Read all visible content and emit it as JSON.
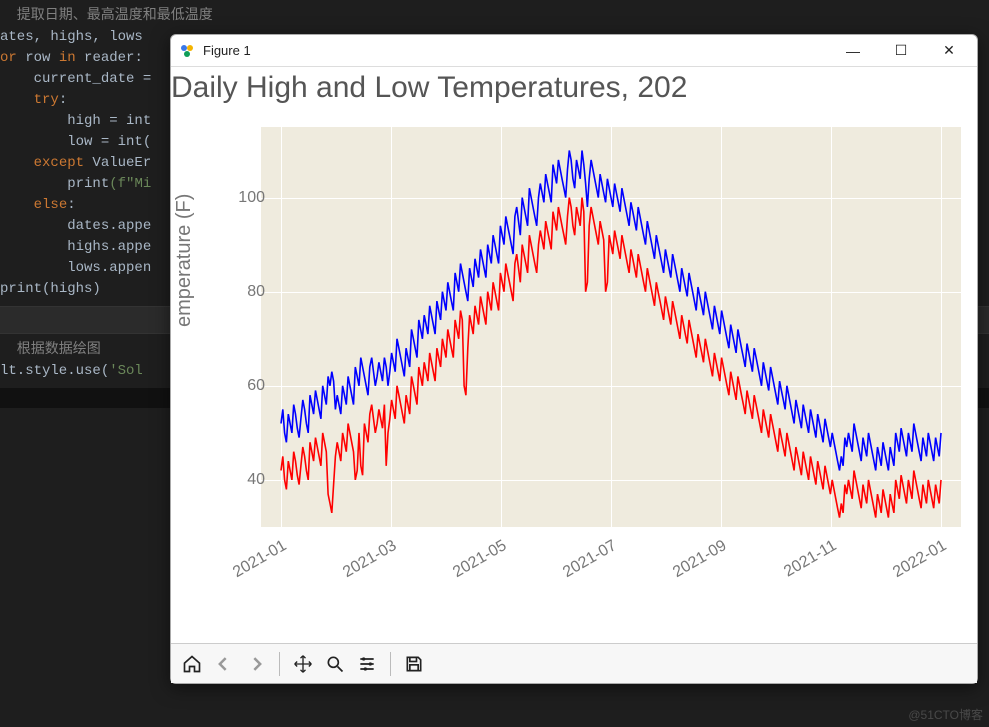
{
  "editor": {
    "comment1": "  提取日期、最高温度和最低温度",
    "l1": "ates, highs, lows",
    "l2_a": "or ",
    "l2_b": "row ",
    "l2_c": "in ",
    "l2_d": "reader:",
    "l3": "    current_date =",
    "l4_a": "    ",
    "l4_b": "try",
    "l4_c": ":",
    "l5": "        high = int",
    "l6": "        low = int(",
    "l7_a": "    ",
    "l7_b": "except ",
    "l7_c": "ValueEr",
    "l8_a": "        ",
    "l8_b": "print",
    "l8_c": "(f\"Mi",
    "l9_a": "    ",
    "l9_b": "else",
    "l9_c": ":",
    "l10": "        dates.appe",
    "l11": "        highs.appe",
    "l12": "        lows.appen",
    "l13_a": "print",
    "l13_b": "(highs)",
    "comment2": "  根据数据绘图",
    "l14_a": "lt.style.use(",
    "l14_b": "'Sol"
  },
  "figure": {
    "window_title": "Figure 1",
    "minimize": "—",
    "maximize": "☐",
    "close": "✕"
  },
  "toolbar": {
    "home": "home-icon",
    "back": "back-icon",
    "forward": "forward-icon",
    "pan": "pan-icon",
    "zoom": "zoom-icon",
    "config": "config-icon",
    "save": "save-icon"
  },
  "watermark": "@51CTO博客",
  "chart_data": {
    "type": "line",
    "title": "Daily High and Low Temperatures, 202",
    "ylabel": "emperature (F)",
    "xlabel": "",
    "ylim": [
      30,
      115
    ],
    "yticks": [
      40,
      60,
      80,
      100
    ],
    "xticks": [
      "2021-01",
      "2021-03",
      "2021-05",
      "2021-07",
      "2021-09",
      "2021-11",
      "2022-01"
    ],
    "x_start": "2021-01-15",
    "x_end": "2022-01-15",
    "colors": {
      "highs": "#0000ff",
      "lows": "#ff0000"
    },
    "series": [
      {
        "name": "highs",
        "values": [
          52,
          55,
          50,
          48,
          54,
          52,
          50,
          56,
          54,
          51,
          49,
          53,
          57,
          55,
          52,
          50,
          58,
          56,
          54,
          59,
          57,
          55,
          53,
          60,
          58,
          56,
          62,
          60,
          63,
          61,
          55,
          58,
          56,
          54,
          60,
          58,
          56,
          62,
          60,
          58,
          56,
          64,
          62,
          60,
          66,
          64,
          62,
          60,
          58,
          64,
          66,
          63,
          60,
          62,
          65,
          63,
          61,
          66,
          64,
          60,
          63,
          67,
          65,
          63,
          70,
          68,
          66,
          64,
          62,
          68,
          66,
          64,
          72,
          70,
          68,
          66,
          74,
          72,
          70,
          75,
          73,
          71,
          77,
          75,
          73,
          71,
          78,
          76,
          74,
          80,
          78,
          76,
          82,
          80,
          78,
          76,
          84,
          82,
          80,
          86,
          84,
          82,
          80,
          78,
          85,
          83,
          81,
          87,
          85,
          83,
          89,
          87,
          85,
          83,
          90,
          88,
          86,
          92,
          90,
          88,
          86,
          94,
          92,
          90,
          96,
          94,
          92,
          90,
          88,
          96,
          98,
          95,
          92,
          100,
          98,
          96,
          94,
          102,
          100,
          98,
          96,
          94,
          100,
          103,
          101,
          99,
          105,
          103,
          101,
          99,
          107,
          105,
          103,
          108,
          106,
          104,
          102,
          100,
          106,
          110,
          108,
          104,
          102,
          108,
          106,
          104,
          110,
          107,
          103,
          98,
          104,
          108,
          106,
          104,
          102,
          100,
          105,
          103,
          101,
          99,
          104,
          102,
          100,
          98,
          103,
          101,
          99,
          97,
          102,
          100,
          98,
          96,
          94,
          99,
          97,
          95,
          93,
          98,
          96,
          94,
          92,
          90,
          95,
          93,
          91,
          89,
          87,
          92,
          90,
          88,
          86,
          84,
          89,
          87,
          85,
          83,
          88,
          86,
          84,
          82,
          80,
          85,
          83,
          81,
          79,
          84,
          82,
          80,
          78,
          76,
          81,
          79,
          77,
          75,
          80,
          78,
          76,
          74,
          72,
          77,
          75,
          73,
          71,
          76,
          74,
          72,
          70,
          68,
          73,
          71,
          69,
          67,
          72,
          70,
          68,
          66,
          64,
          69,
          67,
          65,
          63,
          68,
          66,
          64,
          62,
          60,
          65,
          63,
          61,
          59,
          64,
          62,
          60,
          58,
          56,
          61,
          59,
          57,
          55,
          60,
          58,
          56,
          54,
          52,
          57,
          55,
          53,
          51,
          56,
          54,
          52,
          50,
          55,
          53,
          51,
          49,
          54,
          52,
          50,
          48,
          53,
          51,
          49,
          47,
          50,
          48,
          46,
          44,
          42,
          45,
          43,
          49,
          47,
          50,
          48,
          46,
          52,
          50,
          48,
          46,
          44,
          49,
          47,
          45,
          50,
          48,
          46,
          44,
          42,
          47,
          45,
          43,
          48,
          46,
          44,
          42,
          47,
          45,
          43,
          50,
          48,
          46,
          51,
          49,
          47,
          45,
          50,
          48,
          46,
          52,
          50,
          48,
          46,
          44,
          49,
          47,
          45,
          50,
          48,
          46,
          44,
          49,
          47,
          45,
          50
        ]
      },
      {
        "name": "lows",
        "values": [
          42,
          45,
          40,
          38,
          44,
          42,
          40,
          46,
          44,
          41,
          39,
          43,
          47,
          45,
          42,
          40,
          48,
          46,
          44,
          49,
          47,
          45,
          43,
          50,
          48,
          46,
          37,
          35,
          33,
          39,
          45,
          48,
          46,
          44,
          50,
          48,
          46,
          52,
          50,
          48,
          46,
          40,
          42,
          50,
          43,
          41,
          52,
          50,
          48,
          54,
          56,
          53,
          50,
          52,
          55,
          53,
          51,
          56,
          43,
          50,
          53,
          57,
          55,
          53,
          60,
          58,
          56,
          54,
          52,
          58,
          56,
          54,
          62,
          60,
          58,
          56,
          64,
          62,
          60,
          65,
          63,
          61,
          67,
          65,
          63,
          61,
          68,
          66,
          64,
          70,
          68,
          66,
          72,
          70,
          68,
          66,
          74,
          72,
          70,
          76,
          74,
          60,
          58,
          68,
          75,
          73,
          71,
          77,
          75,
          73,
          79,
          77,
          75,
          73,
          80,
          78,
          76,
          82,
          80,
          78,
          76,
          84,
          82,
          80,
          86,
          84,
          82,
          80,
          78,
          86,
          88,
          85,
          82,
          90,
          88,
          86,
          84,
          92,
          90,
          88,
          86,
          84,
          90,
          93,
          91,
          89,
          95,
          93,
          91,
          89,
          97,
          95,
          93,
          98,
          96,
          94,
          92,
          90,
          96,
          100,
          98,
          94,
          92,
          98,
          96,
          94,
          100,
          97,
          80,
          82,
          94,
          98,
          96,
          94,
          92,
          90,
          95,
          93,
          91,
          80,
          82,
          92,
          90,
          88,
          93,
          91,
          89,
          87,
          92,
          90,
          88,
          86,
          84,
          89,
          87,
          85,
          83,
          88,
          86,
          84,
          82,
          80,
          85,
          83,
          81,
          79,
          77,
          82,
          80,
          78,
          76,
          74,
          79,
          77,
          75,
          73,
          78,
          76,
          74,
          72,
          70,
          75,
          73,
          71,
          69,
          74,
          72,
          70,
          68,
          66,
          71,
          69,
          67,
          65,
          70,
          68,
          66,
          64,
          62,
          67,
          65,
          63,
          61,
          66,
          64,
          62,
          60,
          58,
          63,
          61,
          59,
          57,
          62,
          60,
          58,
          56,
          54,
          59,
          57,
          55,
          53,
          58,
          56,
          54,
          52,
          50,
          55,
          53,
          51,
          49,
          54,
          52,
          50,
          48,
          46,
          51,
          49,
          47,
          45,
          50,
          48,
          46,
          44,
          42,
          47,
          45,
          43,
          41,
          46,
          44,
          42,
          40,
          45,
          43,
          41,
          39,
          44,
          42,
          40,
          38,
          43,
          41,
          39,
          37,
          40,
          38,
          36,
          34,
          32,
          35,
          33,
          39,
          37,
          40,
          38,
          36,
          42,
          40,
          38,
          36,
          34,
          39,
          37,
          35,
          40,
          38,
          36,
          34,
          32,
          37,
          35,
          33,
          38,
          36,
          34,
          32,
          37,
          35,
          33,
          40,
          38,
          36,
          41,
          39,
          37,
          35,
          40,
          38,
          36,
          42,
          40,
          38,
          36,
          34,
          39,
          37,
          35,
          40,
          38,
          36,
          34,
          39,
          37,
          35,
          40
        ]
      }
    ]
  }
}
